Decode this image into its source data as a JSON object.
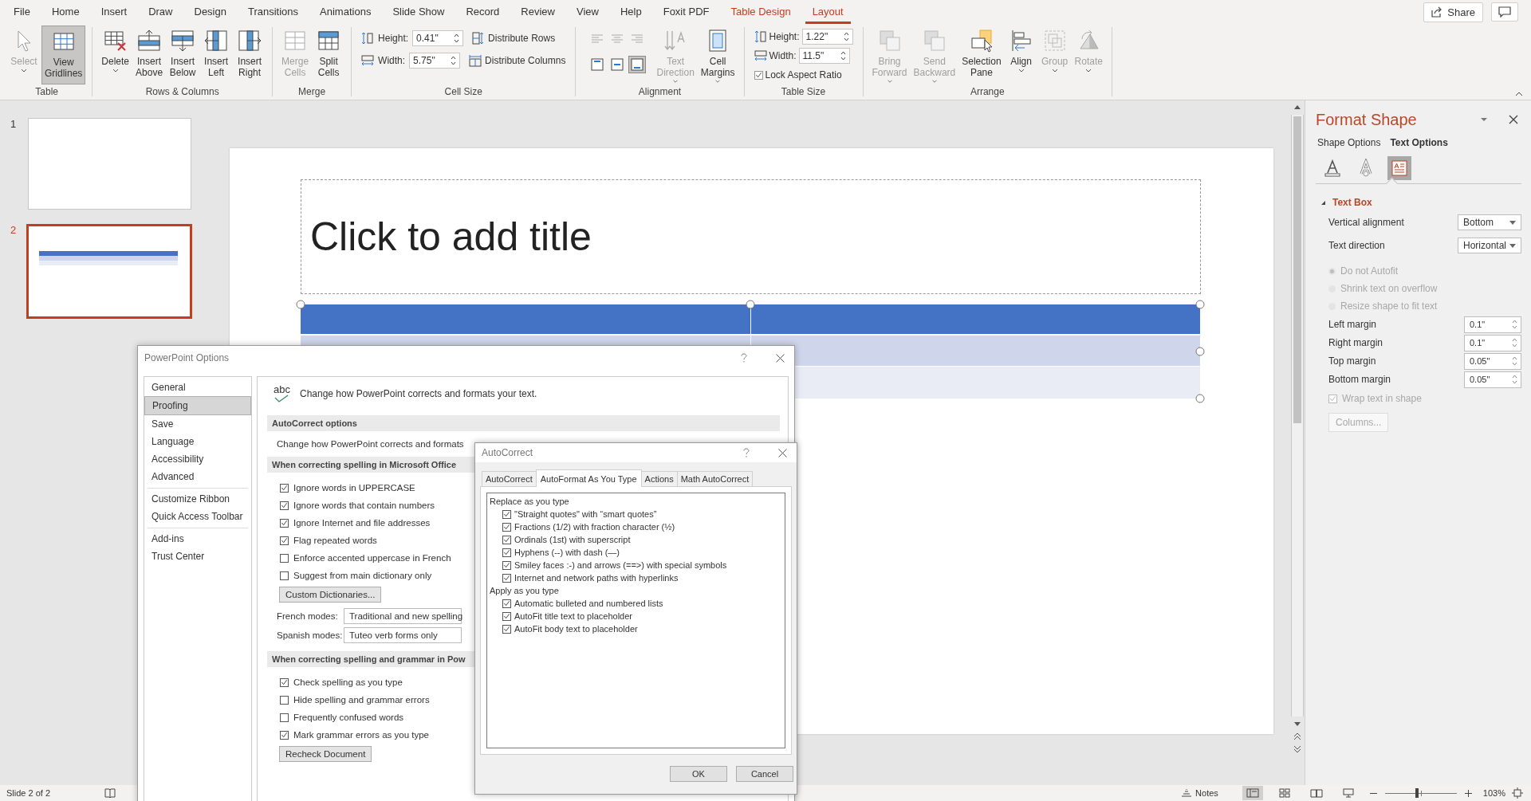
{
  "ribbon_tabs": [
    {
      "label": "File",
      "selected": false,
      "contextual": false
    },
    {
      "label": "Home",
      "selected": false,
      "contextual": false
    },
    {
      "label": "Insert",
      "selected": false,
      "contextual": false
    },
    {
      "label": "Draw",
      "selected": false,
      "contextual": false
    },
    {
      "label": "Design",
      "selected": false,
      "contextual": false
    },
    {
      "label": "Transitions",
      "selected": false,
      "contextual": false
    },
    {
      "label": "Animations",
      "selected": false,
      "contextual": false
    },
    {
      "label": "Slide Show",
      "selected": false,
      "contextual": false
    },
    {
      "label": "Record",
      "selected": false,
      "contextual": false
    },
    {
      "label": "Review",
      "selected": false,
      "contextual": false
    },
    {
      "label": "View",
      "selected": false,
      "contextual": false
    },
    {
      "label": "Help",
      "selected": false,
      "contextual": false
    },
    {
      "label": "Foxit PDF",
      "selected": false,
      "contextual": false
    },
    {
      "label": "Table Design",
      "selected": false,
      "contextual": true
    },
    {
      "label": "Layout",
      "selected": true,
      "contextual": true
    }
  ],
  "share_button": {
    "label": "Share"
  },
  "ribbon_groups": [
    {
      "kind": "buttons",
      "label": "Table",
      "buttons": [
        {
          "label": "Select",
          "disabled": true,
          "on": false,
          "menu": true
        },
        {
          "label": "View Gridlines",
          "disabled": false,
          "on": true,
          "menu": false
        }
      ]
    },
    {
      "kind": "buttons",
      "label": "Rows & Columns",
      "buttons": [
        {
          "label": "Delete",
          "disabled": false,
          "on": false,
          "menu": true
        },
        {
          "label": "Insert Above",
          "disabled": false,
          "on": false,
          "menu": false
        },
        {
          "label": "Insert Below",
          "disabled": false,
          "on": false,
          "menu": false
        },
        {
          "label": "Insert Left",
          "disabled": false,
          "on": false,
          "menu": false
        },
        {
          "label": "Insert Right",
          "disabled": false,
          "on": false,
          "menu": false
        }
      ]
    },
    {
      "kind": "buttons",
      "label": "Merge",
      "buttons": [
        {
          "label": "Merge Cells",
          "disabled": true,
          "on": false,
          "menu": false
        },
        {
          "label": "Split Cells",
          "disabled": false,
          "on": false,
          "menu": false
        }
      ]
    },
    {
      "kind": "cell_size",
      "label": "Cell Size",
      "fields": [
        {
          "label": "Height:",
          "value": "0.41\""
        },
        {
          "label": "Width:",
          "value": "5.75\""
        }
      ],
      "actions": [
        {
          "label": "Distribute Rows"
        },
        {
          "label": "Distribute Columns"
        }
      ]
    },
    {
      "kind": "alignment",
      "label": "Alignment",
      "align_buttons": [
        {
          "selected": false,
          "disabled": true
        },
        {
          "selected": false,
          "disabled": true
        },
        {
          "selected": false,
          "disabled": true
        },
        {
          "selected": false,
          "disabled": false
        },
        {
          "selected": false,
          "disabled": false
        },
        {
          "selected": true,
          "disabled": false
        }
      ],
      "buttons": [
        {
          "label": "Text Direction",
          "disabled": true,
          "on": false,
          "menu": true
        },
        {
          "label": "Cell Margins",
          "disabled": false,
          "on": false,
          "menu": true
        }
      ]
    },
    {
      "kind": "table_size",
      "label": "Table Size",
      "fields": [
        {
          "label": "Height:",
          "value": "1.22\""
        },
        {
          "label": "Width:",
          "value": "11.5\""
        }
      ],
      "lock": {
        "label": "Lock Aspect Ratio",
        "checked": true
      }
    },
    {
      "kind": "buttons",
      "label": "Arrange",
      "buttons": [
        {
          "label": "Bring Forward",
          "disabled": true,
          "on": false,
          "menu": true
        },
        {
          "label": "Send Backward",
          "disabled": true,
          "on": false,
          "menu": true
        },
        {
          "label": "Selection Pane",
          "disabled": false,
          "on": false,
          "menu": false
        },
        {
          "label": "Align",
          "disabled": false,
          "on": false,
          "menu": true
        },
        {
          "label": "Group",
          "disabled": true,
          "on": false,
          "menu": true
        },
        {
          "label": "Rotate",
          "disabled": true,
          "on": false,
          "menu": true
        }
      ]
    }
  ],
  "slides": [
    {
      "number": "1",
      "selected": false,
      "has_table": false
    },
    {
      "number": "2",
      "selected": true,
      "has_table": true
    }
  ],
  "slide": {
    "title_placeholder": "Click to add title"
  },
  "format_pane": {
    "title": "Format Shape",
    "tabs": [
      {
        "label": "Shape Options",
        "selected": false
      },
      {
        "label": "Text Options",
        "selected": true
      }
    ],
    "icon_tabs": [
      {
        "selected": false
      },
      {
        "selected": false
      },
      {
        "selected": true
      }
    ],
    "section": {
      "title": "Text Box",
      "expanded": true
    },
    "selects": [
      {
        "label": "Vertical alignment",
        "value": "Bottom"
      },
      {
        "label": "Text direction",
        "value": "Horizontal"
      }
    ],
    "autofit": [
      {
        "label": "Do not Autofit",
        "selected": true,
        "disabled": true
      },
      {
        "label": "Shrink text on overflow",
        "selected": false,
        "disabled": true
      },
      {
        "label": "Resize shape to fit text",
        "selected": false,
        "disabled": true
      }
    ],
    "margins": [
      {
        "label": "Left margin",
        "value": "0.1\""
      },
      {
        "label": "Right margin",
        "value": "0.1\""
      },
      {
        "label": "Top margin",
        "value": "0.05\""
      },
      {
        "label": "Bottom margin",
        "value": "0.05\""
      }
    ],
    "wrap": {
      "label": "Wrap text in shape",
      "checked": true,
      "disabled": true
    },
    "columns_button": {
      "label": "Columns...",
      "disabled": true
    }
  },
  "options_dialog": {
    "title": "PowerPoint Options",
    "nav_groups": [
      {
        "items": [
          {
            "label": "General",
            "selected": false
          },
          {
            "label": "Proofing",
            "selected": true
          },
          {
            "label": "Save",
            "selected": false
          },
          {
            "label": "Language",
            "selected": false
          },
          {
            "label": "Accessibility",
            "selected": false
          },
          {
            "label": "Advanced",
            "selected": false
          }
        ]
      },
      {
        "items": [
          {
            "label": "Customize Ribbon",
            "selected": false
          },
          {
            "label": "Quick Access Toolbar",
            "selected": false
          }
        ]
      },
      {
        "items": [
          {
            "label": "Add-ins",
            "selected": false
          },
          {
            "label": "Trust Center",
            "selected": false
          }
        ]
      }
    ],
    "header_icon_text": "abc",
    "header": "Change how PowerPoint corrects and formats your text.",
    "sections": [
      {
        "title": "AutoCorrect options",
        "text": "Change how PowerPoint corrects and formats"
      },
      {
        "title": "When correcting spelling in Microsoft Office",
        "checkboxes": [
          {
            "label": "Ignore words in UPPERCASE",
            "checked": true
          },
          {
            "label": "Ignore words that contain numbers",
            "checked": true
          },
          {
            "label": "Ignore Internet and file addresses",
            "checked": true
          },
          {
            "label": "Flag repeated words",
            "checked": true
          },
          {
            "label": "Enforce accented uppercase in French",
            "checked": false
          },
          {
            "label": "Suggest from main dictionary only",
            "checked": false
          }
        ],
        "button": "Custom Dictionaries...",
        "selects": [
          {
            "label": "French modes:",
            "value": "Traditional and new spelling"
          },
          {
            "label": "Spanish modes:",
            "value": "Tuteo verb forms only"
          }
        ]
      },
      {
        "title": "When correcting spelling and grammar in Pow",
        "checkboxes": [
          {
            "label": "Check spelling as you type",
            "checked": true
          },
          {
            "label": "Hide spelling and grammar errors",
            "checked": false
          },
          {
            "label": "Frequently confused words",
            "checked": false
          },
          {
            "label": "Mark grammar errors as you type",
            "checked": true
          }
        ],
        "button": "Recheck Document"
      }
    ]
  },
  "autocorrect_dialog": {
    "title": "AutoCorrect",
    "tabs": [
      {
        "label": "AutoCorrect",
        "selected": false
      },
      {
        "label": "AutoFormat As You Type",
        "selected": true
      },
      {
        "label": "Actions",
        "selected": false
      },
      {
        "label": "Math AutoCorrect",
        "selected": false
      }
    ],
    "groups": [
      {
        "title": "Replace as you type",
        "items": [
          {
            "label": "\"Straight quotes\" with “smart quotes”",
            "checked": true
          },
          {
            "label": "Fractions (1/2) with fraction character (½)",
            "checked": true
          },
          {
            "label": "Ordinals (1st) with superscript",
            "checked": true
          },
          {
            "label": "Hyphens (--) with dash (—)",
            "checked": true
          },
          {
            "label": "Smiley faces :-) and arrows (==>) with special symbols",
            "checked": true
          },
          {
            "label": "Internet and network paths with hyperlinks",
            "checked": true
          }
        ]
      },
      {
        "title": "Apply as you type",
        "items": [
          {
            "label": "Automatic bulleted and numbered lists",
            "checked": true
          },
          {
            "label": "AutoFit title text to placeholder",
            "checked": true
          },
          {
            "label": "AutoFit body text to placeholder",
            "checked": true
          }
        ]
      }
    ],
    "buttons": [
      "OK",
      "Cancel"
    ]
  },
  "status_bar": {
    "slide_info": "Slide 2 of 2",
    "notes": "Notes",
    "views": [
      {
        "selected": true
      },
      {
        "selected": false
      },
      {
        "selected": false
      },
      {
        "selected": false
      }
    ],
    "zoom": {
      "level": 0.45,
      "percent": "103%"
    }
  }
}
